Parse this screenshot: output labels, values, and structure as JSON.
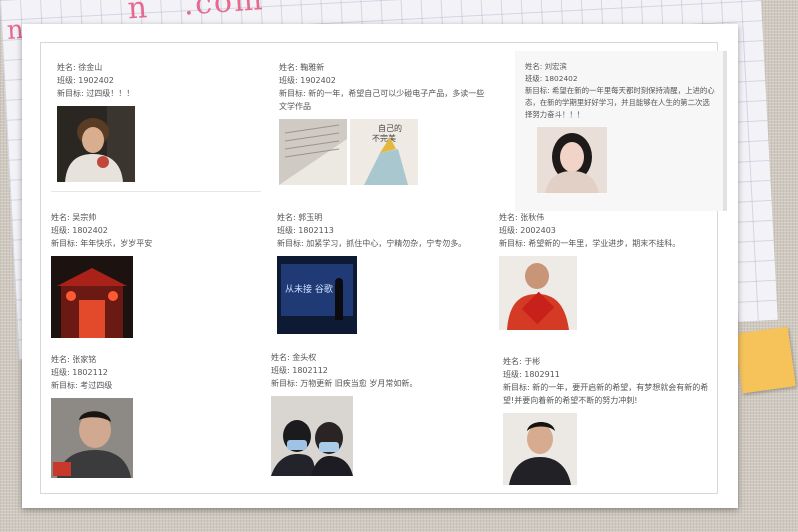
{
  "decoration": {
    "left_text": "n",
    "right_text": "n   .com"
  },
  "labels": {
    "name": "姓名:",
    "class": "班级:",
    "goal": "新目标:"
  },
  "students": [
    {
      "name": "徐金山",
      "class": "1902402",
      "goal": "过四级！！！"
    },
    {
      "name": "鞠雅新",
      "class": "1902402",
      "goal": "新的一年，希望自己可以少碰电子产品，多读一些文学作品"
    },
    {
      "name": "刘宏滨",
      "class": "1802402",
      "goal": "希望在新的一年里每天都时刻保持清醒，上进的心态，在新的学期里好好学习，并且能够在人生的第二次选择努力奋斗！！！"
    },
    {
      "name": "吴宗帅",
      "class": "1802402",
      "goal": "年年快乐，岁岁平安"
    },
    {
      "name": "郭玉明",
      "class": "1802113",
      "goal": "加紧学习，抓住中心，宁精勿杂，宁专勿多。"
    },
    {
      "name": "张秋伟",
      "class": "2002403",
      "goal": "希望新的一年里，学业进步，期末不挂科。"
    },
    {
      "name": "张家铭",
      "class": "1802112",
      "goal": "考过四级"
    },
    {
      "name": "金头权",
      "class": "1802112",
      "goal": "万物更新 旧疾当愈 岁月常如新。"
    },
    {
      "name": "于彬",
      "class": "1802911",
      "goal": "新的一年，要开启新的希望，有梦想就会有新的希望!并要向着新的希望不断的努力冲刺!"
    }
  ],
  "photo_text": {
    "book": "自己的\n不完美",
    "screen": "从未接 谷歌"
  }
}
